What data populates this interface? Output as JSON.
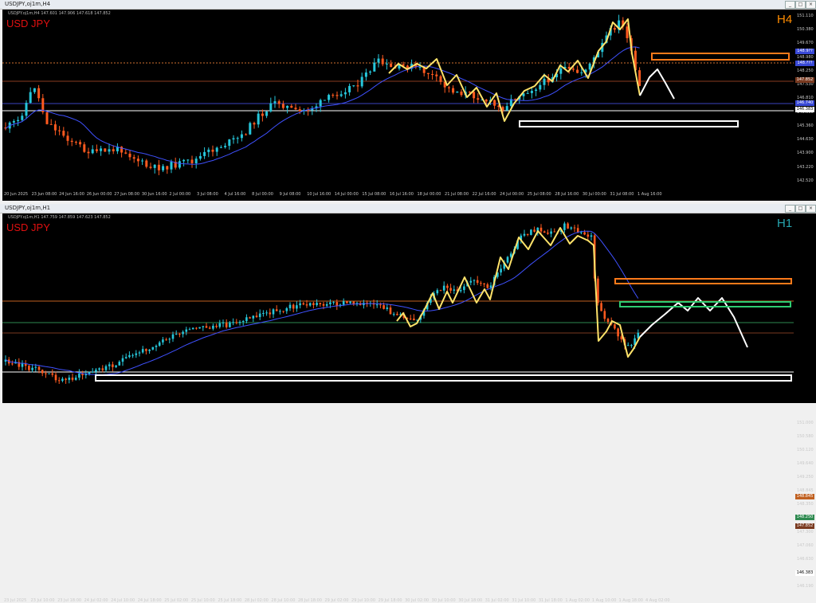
{
  "colors": {
    "background": "#000000",
    "bull": "#26c6da",
    "bear": "#ff5a1f",
    "ma": "#3f51ff",
    "zigzag": "#ffe36a",
    "projection": "#ffffff",
    "orange_zone": "#ff7a1a",
    "green_zone": "#2ecc71",
    "white_zone": "#ffffff",
    "symbol": "#e01010",
    "tf_h4": "#ff8c00",
    "tf_h1": "#26a6b0"
  },
  "top": {
    "window_title": "USDJPY,oj1m,H4",
    "ohlc": "USDJPY.oj1m,H4  147.601 147.906 147.618 147.852",
    "symbol": "USD JPY",
    "timeframe": "H4",
    "prices": [
      "151.110",
      "150.380",
      "149.670",
      "148.980",
      "148.250",
      "147.530",
      "146.810",
      "146.090",
      "145.360",
      "144.630",
      "143.900",
      "143.220",
      "142.520"
    ],
    "tags": [
      "148.9??",
      "148.???",
      "147.852",
      "146.740",
      "146.383"
    ],
    "xlabels": [
      "20 Jun 2025",
      "23 Jun 08:00",
      "24 Jun 16:00",
      "26 Jun 00:00",
      "27 Jun 08:00",
      "30 Jun 16:00",
      "2 Jul 00:00",
      "3 Jul 08:00",
      "4 Jul 16:00",
      "8 Jul 00:00",
      "9 Jul 08:00",
      "10 Jul 16:00",
      "14 Jul 00:00",
      "15 Jul 08:00",
      "16 Jul 16:00",
      "18 Jul 00:00",
      "21 Jul 08:00",
      "22 Jul 16:00",
      "24 Jul 00:00",
      "25 Jul 08:00",
      "28 Jul 16:00",
      "30 Jul 00:00",
      "31 Jul 08:00",
      "1 Aug 16:00"
    ]
  },
  "bottom": {
    "window_title": "USDJPY,oj1m,H1",
    "ohlc": "USDJPY.oj1m,H1  147.759 147.859 147.623 147.852",
    "symbol": "USD JPY",
    "timeframe": "H1",
    "prices": [
      "151.000",
      "150.580",
      "150.120",
      "149.640",
      "149.250",
      "148.845",
      "148.350",
      "147.852",
      "147.300",
      "147.060",
      "146.630",
      "146.383",
      "146.190"
    ],
    "tags": [
      "148.845",
      "148.250",
      "147.852",
      "146.383"
    ],
    "xlabels": [
      "23 Jul 2025",
      "23 Jul 10:00",
      "23 Jul 18:00",
      "24 Jul 02:00",
      "24 Jul 10:00",
      "24 Jul 18:00",
      "25 Jul 02:00",
      "25 Jul 10:00",
      "25 Jul 18:00",
      "28 Jul 02:00",
      "28 Jul 10:00",
      "28 Jul 18:00",
      "29 Jul 02:00",
      "29 Jul 10:00",
      "29 Jul 18:00",
      "30 Jul 02:00",
      "30 Jul 10:00",
      "30 Jul 18:00",
      "31 Jul 02:00",
      "31 Jul 10:00",
      "31 Jul 18:00",
      "1 Aug 02:00",
      "1 Aug 10:00",
      "1 Aug 18:00",
      "4 Aug 02:00"
    ]
  }
}
